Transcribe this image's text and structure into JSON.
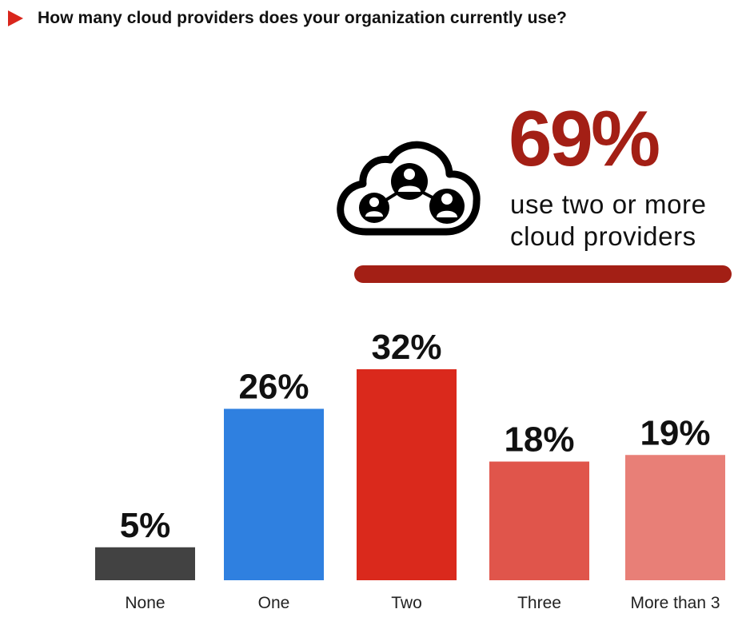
{
  "header": {
    "title": "How many cloud providers does your organization currently use?",
    "arrow_color": "#d9261c"
  },
  "highlight": {
    "icon": "cloud-network-users-icon",
    "value": "69%",
    "caption_line1": "use two or more",
    "caption_line2": "cloud providers",
    "accent_color": "#a31f15"
  },
  "chart_data": {
    "type": "bar",
    "title": "How many cloud providers does your organization currently use?",
    "xlabel": "",
    "ylabel": "",
    "categories": [
      "None",
      "One",
      "Two",
      "Three",
      "More than 3"
    ],
    "values": [
      5,
      26,
      32,
      18,
      19
    ],
    "value_labels": [
      "5%",
      "26%",
      "32%",
      "18%",
      "19%"
    ],
    "colors": [
      "#424242",
      "#2f80e0",
      "#da291c",
      "#e0554b",
      "#e87f77"
    ],
    "unit": "%",
    "ylim": [
      0,
      40
    ],
    "grid": false,
    "legend": "none",
    "annotation": "69% use two or more cloud providers"
  }
}
